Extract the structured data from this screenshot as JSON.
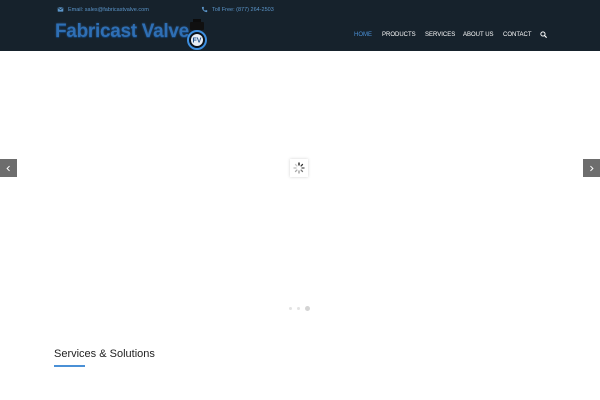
{
  "topbar": {
    "email": "Email: sales@fabricastvalve.com",
    "phone": "Toll Free: (877) 264-2503"
  },
  "logo": {
    "text": "Fabricast Valve",
    "emblem_text": "FV"
  },
  "nav": {
    "items": [
      "HOME",
      "PRODUCTS",
      "SERVICES",
      "ABOUT US",
      "CONTACT"
    ],
    "active": "HOME"
  },
  "slider": {
    "slide_count": 3,
    "active_slide": 3
  },
  "section": {
    "title": "Services & Solutions"
  },
  "colors": {
    "header_bg": "#16222c",
    "accent": "#4a90d6",
    "nav_text": "#ffffff",
    "arrow_bg": "#6d6d6d"
  },
  "icons": {
    "email": "envelope-icon",
    "phone": "phone-icon",
    "search": "search-icon",
    "prev": "chevron-left-icon",
    "next": "chevron-right-icon",
    "loader": "spinner-icon"
  }
}
